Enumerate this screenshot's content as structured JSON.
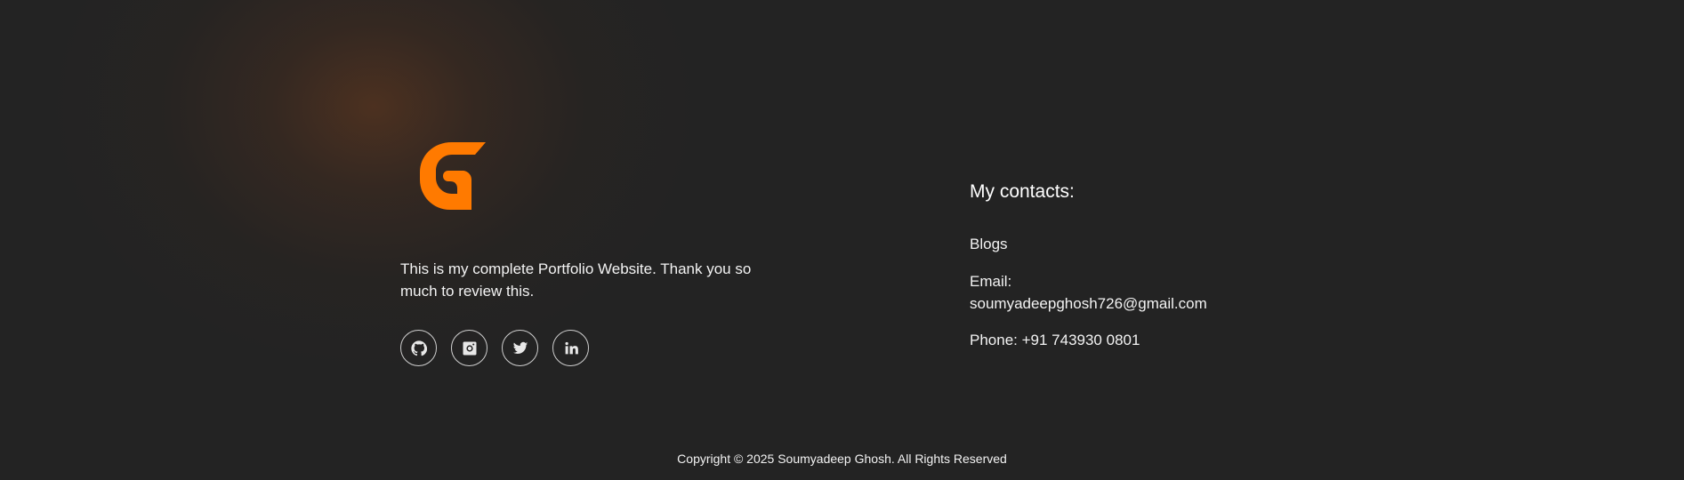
{
  "brand": {
    "logo_letter": "G",
    "accent_color": "#ff7a00"
  },
  "about": {
    "tagline": "This is my complete Portfolio Website. Thank you so much to review this."
  },
  "socials": [
    {
      "icon": "github-icon"
    },
    {
      "icon": "instagram-icon"
    },
    {
      "icon": "twitter-icon"
    },
    {
      "icon": "linkedin-icon"
    }
  ],
  "contacts": {
    "heading": "My contacts:",
    "blogs_label": "Blogs",
    "email_label": "Email:",
    "email_value": "soumyadeepghosh726@gmail.com",
    "phone_text": "Phone: +91 743930 0801"
  },
  "footer": {
    "copyright": "Copyright © 2025 Soumyadeep Ghosh. All Rights Reserved"
  },
  "colors": {
    "background": "#232323",
    "text": "#ffffff",
    "glow": "#6e3c1e"
  }
}
